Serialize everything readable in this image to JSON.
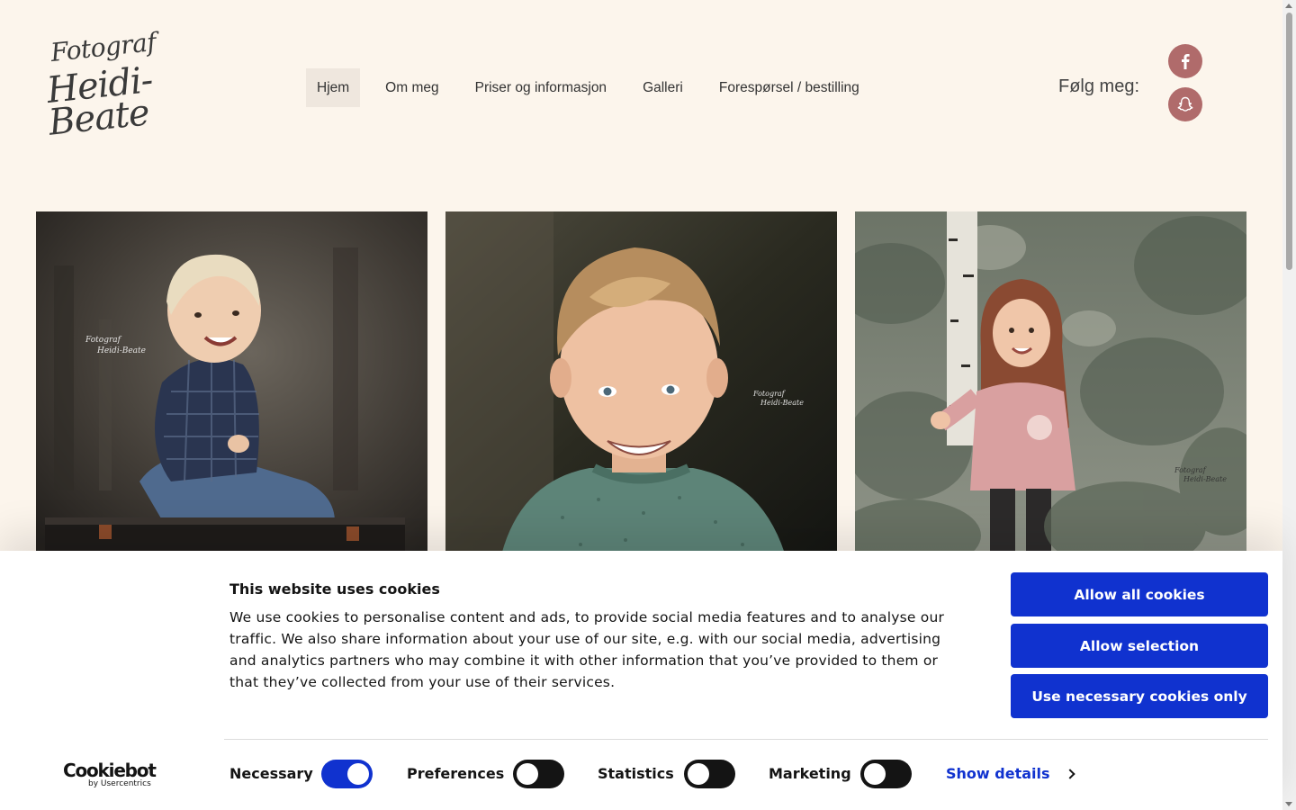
{
  "logo": {
    "line1": "Fotograf",
    "line2": "Heidi-",
    "line3": "Beate"
  },
  "nav": {
    "items": [
      {
        "label": "Hjem",
        "active": true
      },
      {
        "label": "Om meg"
      },
      {
        "label": "Priser og informasjon"
      },
      {
        "label": "Galleri"
      },
      {
        "label": "Forespørsel / bestilling"
      }
    ]
  },
  "social": {
    "label": "Følg meg:",
    "icons": [
      "facebook-icon",
      "snapchat-icon"
    ],
    "color": "#b06b6b"
  },
  "photos": [
    {
      "subject": "toddler in plaid shirt sitting on trunk",
      "watermark": "Fotograf Heidi-Beate"
    },
    {
      "subject": "smiling boy in green knitted sweater",
      "watermark": "Fotograf Heidi-Beate"
    },
    {
      "subject": "girl in pink sweater by birch tree",
      "watermark": "Fotograf Heidi-Beate"
    }
  ],
  "cookie": {
    "title": "This website uses cookies",
    "text": "We use cookies to personalise content and ads, to provide social media features and to analyse our traffic. We also share information about your use of our site, e.g. with our social media, advertising and analytics partners who may combine it with other information that you’ve provided to them or that they’ve collected from your use of their services.",
    "buttons": {
      "allow_all": "Allow all cookies",
      "allow_selection": "Allow selection",
      "necessary_only": "Use necessary cookies only"
    },
    "toggles": [
      {
        "label": "Necessary",
        "on": true
      },
      {
        "label": "Preferences",
        "on": false
      },
      {
        "label": "Statistics",
        "on": false
      },
      {
        "label": "Marketing",
        "on": false
      }
    ],
    "show_details": "Show details",
    "brand": {
      "name": "Cookiebot",
      "sub": "by Usercentrics"
    },
    "accent": "#1032cf"
  },
  "colors": {
    "page_bg": "#fcf5ec",
    "nav_active_bg": "#efe7de"
  }
}
